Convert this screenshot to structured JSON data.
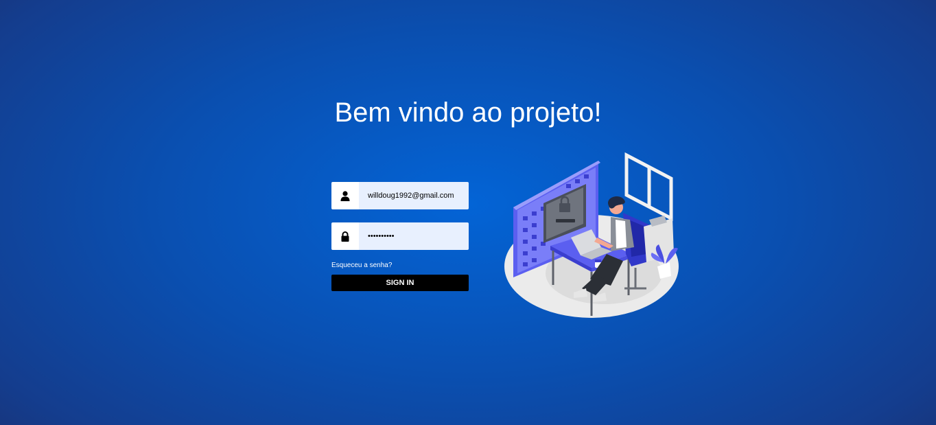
{
  "page": {
    "title": "Bem vindo ao projeto!"
  },
  "login": {
    "email_value": "willdoug1992@gmail.com",
    "password_value": "••••••••••",
    "user_icon": "user-icon",
    "lock_icon": "lock-icon",
    "forgot_label": "Esqueceu a senha?",
    "signin_label": "SIGN IN"
  },
  "illustration": {
    "name": "person-at-desk-security-illustration"
  },
  "colors": {
    "background_center": "#0364d6",
    "background_edge": "#1a2f6e",
    "input_bg": "#e8f0fe",
    "button_bg": "#000000",
    "accent_purple": "#5b5ff0"
  }
}
